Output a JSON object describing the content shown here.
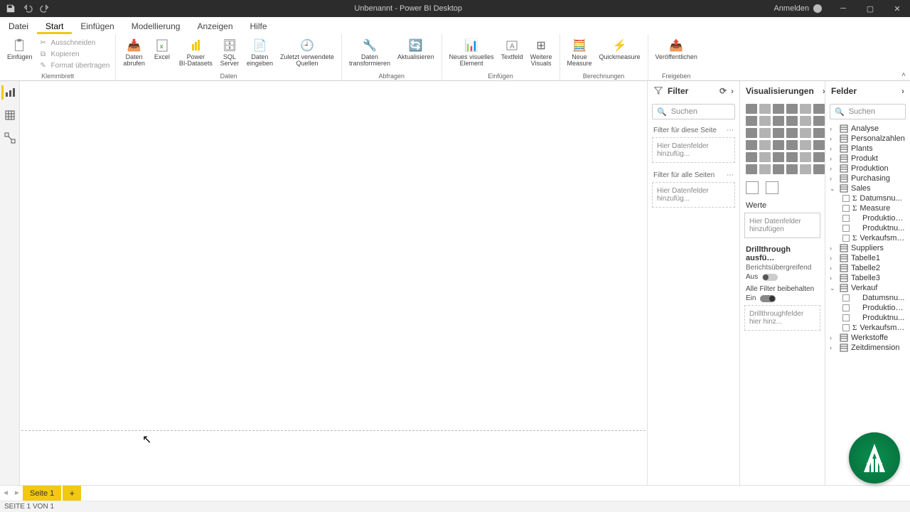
{
  "titlebar": {
    "title": "Unbenannt - Power BI Desktop",
    "signin": "Anmelden"
  },
  "tabs": {
    "file": "Datei",
    "start": "Start",
    "insert": "Einfügen",
    "model": "Modellierung",
    "view": "Anzeigen",
    "help": "Hilfe"
  },
  "ribbon": {
    "clipboard": {
      "paste": "Einfügen",
      "cut": "Ausschneiden",
      "copy": "Kopieren",
      "format": "Format übertragen",
      "group": "Klemmbrett"
    },
    "data": {
      "get": "Daten\nabrufen",
      "excel": "Excel",
      "pbi": "Power\nBI-Datasets",
      "sql": "SQL\nServer",
      "enter": "Daten\neingeben",
      "recent": "Zuletzt verwendete\nQuellen",
      "group": "Daten"
    },
    "queries": {
      "transform": "Daten\ntransformieren",
      "refresh": "Aktualisieren",
      "group": "Abfragen"
    },
    "insert": {
      "visual": "Neues visuelles\nElement",
      "text": "Textfeld",
      "more": "Weitere\nVisuals",
      "group": "Einfügen"
    },
    "calc": {
      "measure": "Neue\nMeasure",
      "quick": "Quickmeasure",
      "group": "Berechnungen"
    },
    "share": {
      "publish": "Veröffentlichen",
      "group": "Freigeben"
    }
  },
  "filter": {
    "title": "Filter",
    "search": "Suchen",
    "page": "Filter für diese Seite",
    "all": "Filter für alle Seiten",
    "drop": "Hier Datenfelder hinzufüg..."
  },
  "viz": {
    "title": "Visualisierungen",
    "values": "Werte",
    "drop": "Hier Datenfelder hinzufügen",
    "drill": "Drillthrough ausfü…",
    "cross": "Berichtsübergreifend",
    "off": "Aus",
    "keep": "Alle Filter beibehalten",
    "on": "Ein",
    "dthru": "Drillthroughfelder hier hinz..."
  },
  "fields": {
    "title": "Felder",
    "search": "Suchen",
    "tables": [
      {
        "name": "Analyse",
        "open": false
      },
      {
        "name": "Personalzahlen",
        "open": false
      },
      {
        "name": "Plants",
        "open": false
      },
      {
        "name": "Produkt",
        "open": false
      },
      {
        "name": "Produktion",
        "open": false
      },
      {
        "name": "Purchasing",
        "open": false
      },
      {
        "name": "Sales",
        "open": true,
        "cols": [
          {
            "name": "Datumsnu...",
            "sigma": true
          },
          {
            "name": "Measure",
            "sigma": true
          },
          {
            "name": "Produktion...",
            "sigma": false
          },
          {
            "name": "Produktnu...",
            "sigma": false
          },
          {
            "name": "Verkaufsme...",
            "sigma": true
          }
        ]
      },
      {
        "name": "Suppliers",
        "open": false
      },
      {
        "name": "Tabelle1",
        "open": false
      },
      {
        "name": "Tabelle2",
        "open": false
      },
      {
        "name": "Tabelle3",
        "open": false
      },
      {
        "name": "Verkauf",
        "open": true,
        "cols": [
          {
            "name": "Datumsnu...",
            "sigma": false
          },
          {
            "name": "Produktion...",
            "sigma": false
          },
          {
            "name": "Produktnu...",
            "sigma": false
          },
          {
            "name": "Verkaufsme...",
            "sigma": true
          }
        ]
      },
      {
        "name": "Werkstoffe",
        "open": false
      },
      {
        "name": "Zeitdimension",
        "open": false
      }
    ]
  },
  "page": {
    "tab": "Seite 1",
    "status": "SEITE 1 VON 1"
  }
}
